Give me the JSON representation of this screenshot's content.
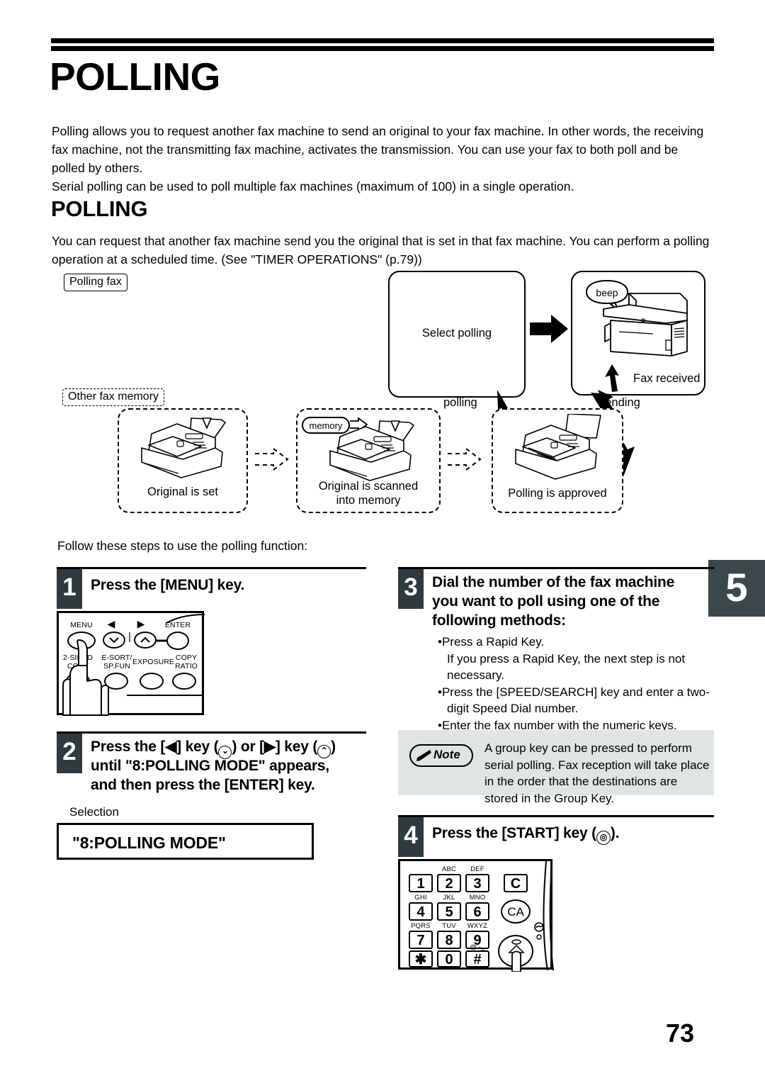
{
  "page": {
    "chapter_tab": "5",
    "page_number": "73",
    "h1_title": "POLLING",
    "h2_title": "POLLING",
    "intro_paragraph": "Polling allows you to request another fax machine to send an original to your fax machine. In other words, the receiving fax machine, not the transmitting fax machine, activates the transmission. You can use your fax to both poll and be polled by others.\nSerial polling can be used to poll multiple fax machines (maximum of 100) in a single operation.",
    "section_paragraph": "You can request that another fax machine send you the original that is set in that fax machine. You can perform a polling operation at a scheduled time. (See \"TIMER OPERATIONS\" (p.79))",
    "follow_steps_line": "Follow these steps to use the polling function:"
  },
  "diagram": {
    "tag_polling_fax": "Polling fax",
    "tag_other_fax_memory": "Other fax memory",
    "select_polling_label": "Select polling",
    "fax_received_label": "Fax received",
    "beep_label": "beep",
    "memory_label": "memory",
    "polling_arrow_label": "polling",
    "sending_arrow_label": "sending",
    "panels": [
      {
        "label_line1": "Original is set",
        "label_line2": ""
      },
      {
        "label_line1": "Original is scanned",
        "label_line2": "into memory"
      },
      {
        "label_line1": "Polling is approved",
        "label_line2": ""
      }
    ]
  },
  "steps": [
    {
      "number": "1",
      "title": "Press the [MENU] key."
    },
    {
      "number": "2",
      "title_line1": "Press the [◀] key (⌄) or [▶] key (⌃)",
      "title_line2": "until \"8:POLLING MODE\" appears,",
      "title_line3": "and then press the [ENTER] key.",
      "selection_caption": "Selection",
      "selection_value": "\"8:POLLING MODE\""
    },
    {
      "number": "3",
      "title_line1": "Dial the number of the fax machine",
      "title_line2": "you want to poll using one of the",
      "title_line3": "following methods:",
      "bullets": [
        {
          "main": "Press a Rapid Key.",
          "cont": "If you press a Rapid Key, the next step is not necessary."
        },
        {
          "main": "Press the [SPEED/SEARCH] key and enter a two-digit Speed Dial number.",
          "cont": ""
        },
        {
          "main": "Enter the fax number with the numeric keys.",
          "cont": ""
        }
      ]
    },
    {
      "number": "4",
      "title": "Press the [START] key (   )."
    }
  ],
  "note": {
    "badge_label": "Note",
    "text": "A group key can be pressed to perform serial polling. Fax reception will take place in the order that the destinations are stored in the Group Key."
  },
  "control_panel": {
    "menu_label": "MENU",
    "enter_label": "ENTER",
    "left_arrow": "◀",
    "right_arrow": "▶",
    "row2_labels": [
      "2-SIDED\nCOPY",
      "E-SORT/\nSP.FUN",
      "EXPOSURE",
      "COPY\nRATIO"
    ]
  },
  "keypad": {
    "keys": [
      {
        "digit": "1",
        "letters": ""
      },
      {
        "digit": "2",
        "letters": "ABC"
      },
      {
        "digit": "3",
        "letters": "DEF"
      },
      {
        "digit": "4",
        "letters": "GHI"
      },
      {
        "digit": "5",
        "letters": "JKL"
      },
      {
        "digit": "6",
        "letters": "MNO"
      },
      {
        "digit": "7",
        "letters": "PQRS"
      },
      {
        "digit": "8",
        "letters": "TUV"
      },
      {
        "digit": "9",
        "letters": "WXYZ"
      },
      {
        "digit": "✱",
        "letters": ""
      },
      {
        "digit": "0",
        "letters": ""
      },
      {
        "digit": "#",
        "letters": "@.-_"
      }
    ],
    "clear_key": "C",
    "clear_all_key": "CA"
  },
  "colors": {
    "badge_dark": "#2f3a3e",
    "chapter_tab": "#3b474b",
    "note_background": "#dfe4e4",
    "ink": "#000000"
  }
}
